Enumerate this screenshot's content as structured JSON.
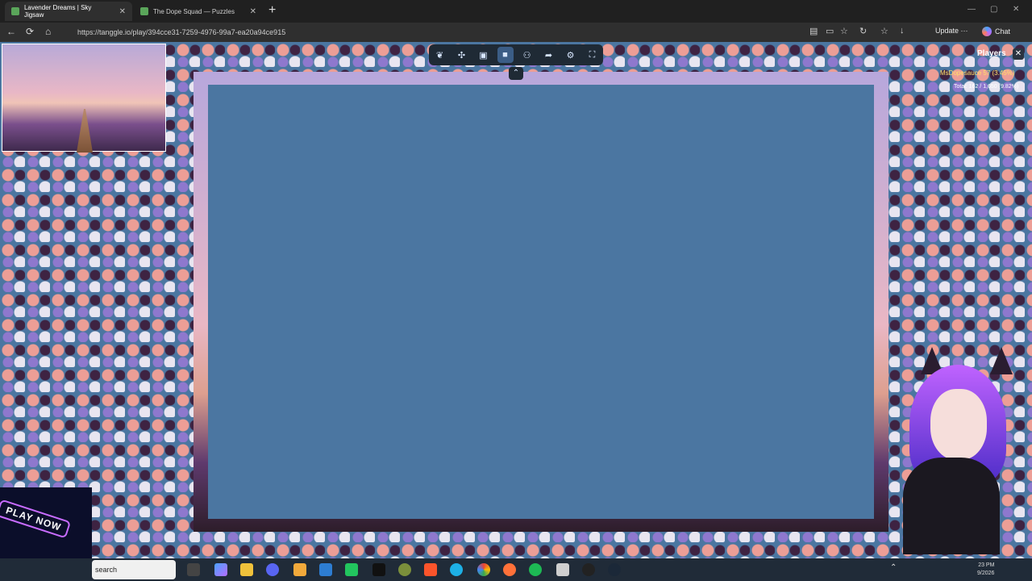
{
  "browser": {
    "tabs": [
      {
        "label": "Lavender Dreams | Sky Jigsaw",
        "active": true
      },
      {
        "label": "The Dope Squad — Puzzles",
        "active": false
      }
    ],
    "url": "https://tanggle.io/play/394cce31-7259-4976-99a7-ea20a94ce915",
    "update_label": "Update",
    "chat_label": "Chat"
  },
  "puzzle": {
    "players_title": "Players",
    "player": {
      "name": "MsDopesauce",
      "score": "57 (3.45%)"
    },
    "total": "Total: 162 / 1,650 (9.82%)",
    "toolbar_icons": [
      "leaf-icon",
      "puzzle-piece-icon",
      "image-icon",
      "background-icon",
      "players-icon",
      "share-icon",
      "settings-icon",
      "fullscreen-icon"
    ]
  },
  "overlay": {
    "playnow": "PLAY NOW"
  },
  "taskbar": {
    "search_label": "search",
    "time": "23 PM",
    "date": "9/2026"
  },
  "colors": {
    "table": "#4b76a1",
    "toolbar": "#1f2a35"
  }
}
